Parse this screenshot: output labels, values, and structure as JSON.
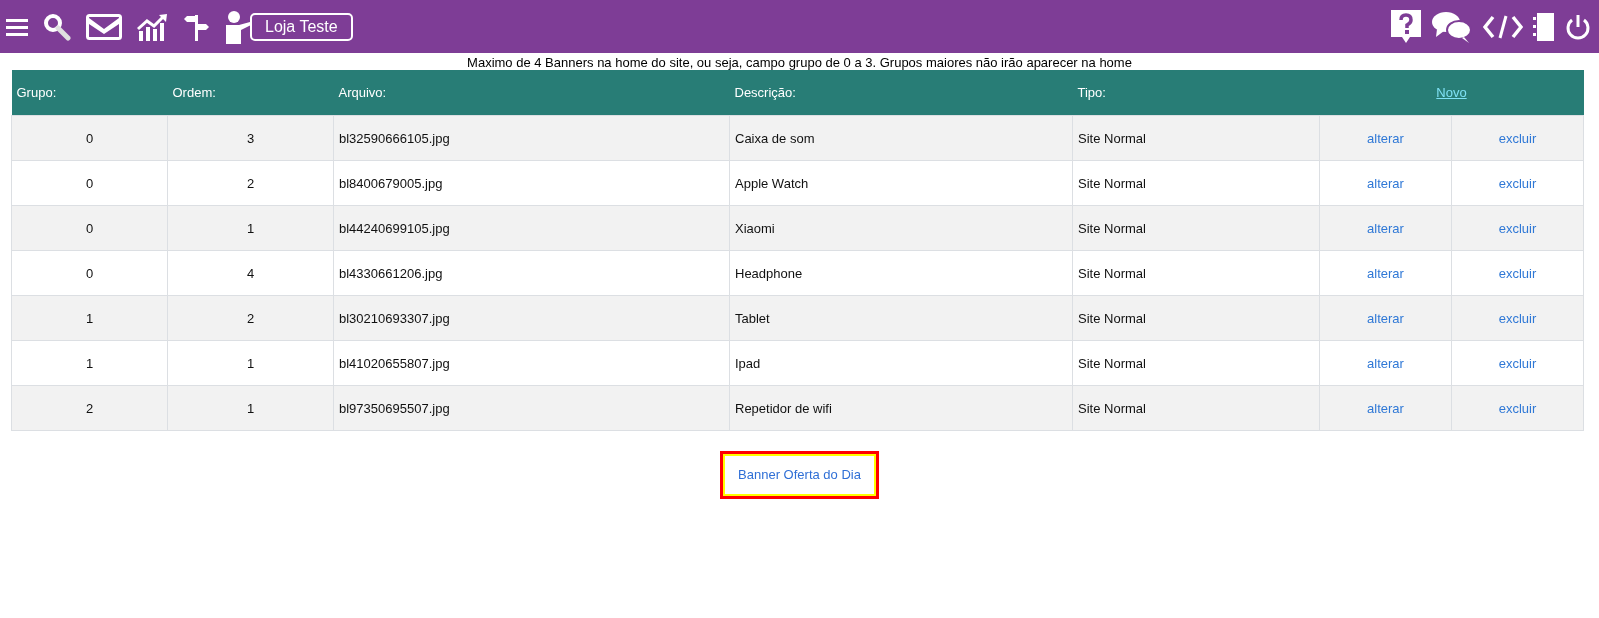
{
  "topbar": {
    "store_button": "Loja Teste"
  },
  "notice": "Maximo de 4 Banners na home do site, ou seja, campo grupo de 0 a 3. Grupos maiores não irão aparecer na home",
  "table": {
    "columns": [
      "Grupo:",
      "Ordem:",
      "Arquivo:",
      "Descrição:",
      "Tipo:"
    ],
    "new_link": "Novo",
    "rows": [
      {
        "grupo": "0",
        "ordem": "3",
        "arquivo": "bl32590666105.jpg",
        "descricao": "Caixa de som",
        "tipo": "Site Normal",
        "edit": "alterar",
        "delete": "excluir"
      },
      {
        "grupo": "0",
        "ordem": "2",
        "arquivo": "bl8400679005.jpg",
        "descricao": "Apple Watch",
        "tipo": "Site Normal",
        "edit": "alterar",
        "delete": "excluir"
      },
      {
        "grupo": "0",
        "ordem": "1",
        "arquivo": "bl44240699105.jpg",
        "descricao": "Xiaomi",
        "tipo": "Site Normal",
        "edit": "alterar",
        "delete": "excluir"
      },
      {
        "grupo": "0",
        "ordem": "4",
        "arquivo": "bl4330661206.jpg",
        "descricao": "Headphone",
        "tipo": "Site Normal",
        "edit": "alterar",
        "delete": "excluir"
      },
      {
        "grupo": "1",
        "ordem": "2",
        "arquivo": "bl30210693307.jpg",
        "descricao": "Tablet",
        "tipo": "Site Normal",
        "edit": "alterar",
        "delete": "excluir"
      },
      {
        "grupo": "1",
        "ordem": "1",
        "arquivo": "bl41020655807.jpg",
        "descricao": "Ipad",
        "tipo": "Site Normal",
        "edit": "alterar",
        "delete": "excluir"
      },
      {
        "grupo": "2",
        "ordem": "1",
        "arquivo": "bl97350695507.jpg",
        "descricao": "Repetidor de wifi",
        "tipo": "Site Normal",
        "edit": "alterar",
        "delete": "excluir"
      }
    ]
  },
  "offer_button": "Banner Oferta do Dia"
}
